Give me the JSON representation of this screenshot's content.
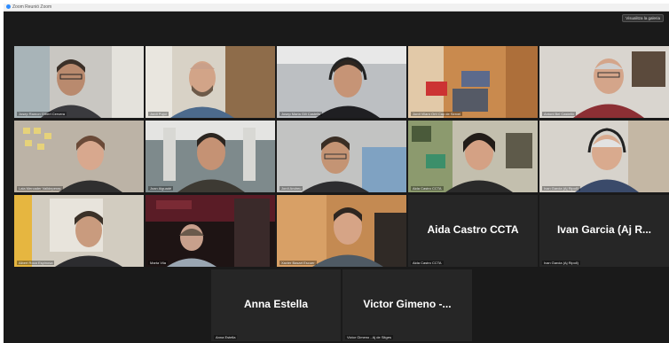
{
  "window": {
    "title": "Zoom Reunió Zoom"
  },
  "toolbar": {
    "view_label": "Visualitza la galeria"
  },
  "participants": [
    {
      "label": "Josep Ramon Gibert Cervera",
      "video": true
    },
    {
      "label": "Jordi Pujol",
      "video": true
    },
    {
      "label": "Josep Maria Gili Castells",
      "video": true
    },
    {
      "label": "Jordi Vilaró Ortí Cap de Servei",
      "video": true
    },
    {
      "label": "Antoni Bel Castelló",
      "video": true
    },
    {
      "label": "Laia Mercader Valldeperas",
      "video": true
    },
    {
      "label": "Joan Aiguadé",
      "video": true
    },
    {
      "label": "Jordi Andreu",
      "video": true
    },
    {
      "label": "Aida Castro CCTA",
      "video": true
    },
    {
      "label": "Ivan Garcia (Aj Ripoll)",
      "video": true
    },
    {
      "label": "Albert Roca Espinosa",
      "video": true
    },
    {
      "label": "Marta Vila",
      "video": true
    },
    {
      "label": "Xavier Basart Escuer",
      "video": true
    },
    {
      "label": "Aida Castro CCTA",
      "name_display": "Aida Castro CCTA",
      "video": false
    },
    {
      "label": "Ivan Garcia (Aj Ripoll)",
      "name_display": "Ivan Garcia (Aj R...",
      "video": false
    },
    {
      "label": "Anna Estella",
      "name_display": "Anna Estella",
      "video": false
    },
    {
      "label": "Victor Gimeno - Aj de Sitges",
      "name_display": "Victor Gimeno -...",
      "video": false
    }
  ],
  "colors": {
    "background": "#1a1a1a",
    "tile": "#262626",
    "name_text": "#ffffff"
  }
}
